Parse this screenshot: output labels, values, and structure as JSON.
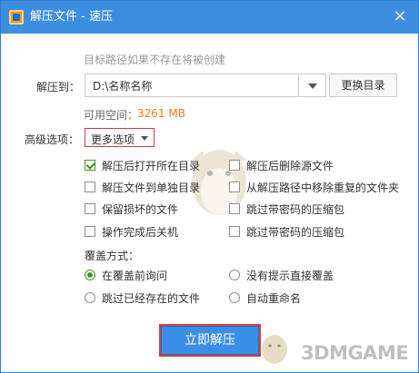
{
  "window": {
    "title": "解压文件 - 速压",
    "close": "×"
  },
  "destination": {
    "hint": "目标路径如果不存在将被创建",
    "label": "解压到：",
    "path": "D:\\名称名称",
    "change_dir_label": "更换目录",
    "space_label": "可用空间：",
    "space_value": "3261 MB"
  },
  "advanced": {
    "label": "高级选项：",
    "more_label": "更多选项",
    "options": [
      {
        "label": "解压后打开所在目录",
        "checked": true
      },
      {
        "label": "解压后删除源文件",
        "checked": false
      },
      {
        "label": "解压文件到单独目录",
        "checked": false
      },
      {
        "label": "从解压路径中移除重复的文件夹",
        "checked": false
      },
      {
        "label": "保留损坏的文件",
        "checked": false
      },
      {
        "label": "跳过带密码的压缩包",
        "checked": false
      },
      {
        "label": "操作完成后关机",
        "checked": false
      },
      {
        "label": "跳过带密码的压缩包",
        "checked": false
      }
    ]
  },
  "overwrite": {
    "label": "覆盖方式：",
    "modes": [
      {
        "label": "在覆盖前询问",
        "selected": true
      },
      {
        "label": "没有提示直接覆盖",
        "selected": false
      },
      {
        "label": "跳过已经存在的文件",
        "selected": false
      },
      {
        "label": "自动重命名",
        "selected": false
      }
    ]
  },
  "actions": {
    "extract_now": "立即解压"
  },
  "watermark": "3DMGAME",
  "colors": {
    "titlebar": "#3d8ee0",
    "accent": "#3a8ee6",
    "highlight_red": "#d9363e",
    "space_value": "#f07a17"
  }
}
